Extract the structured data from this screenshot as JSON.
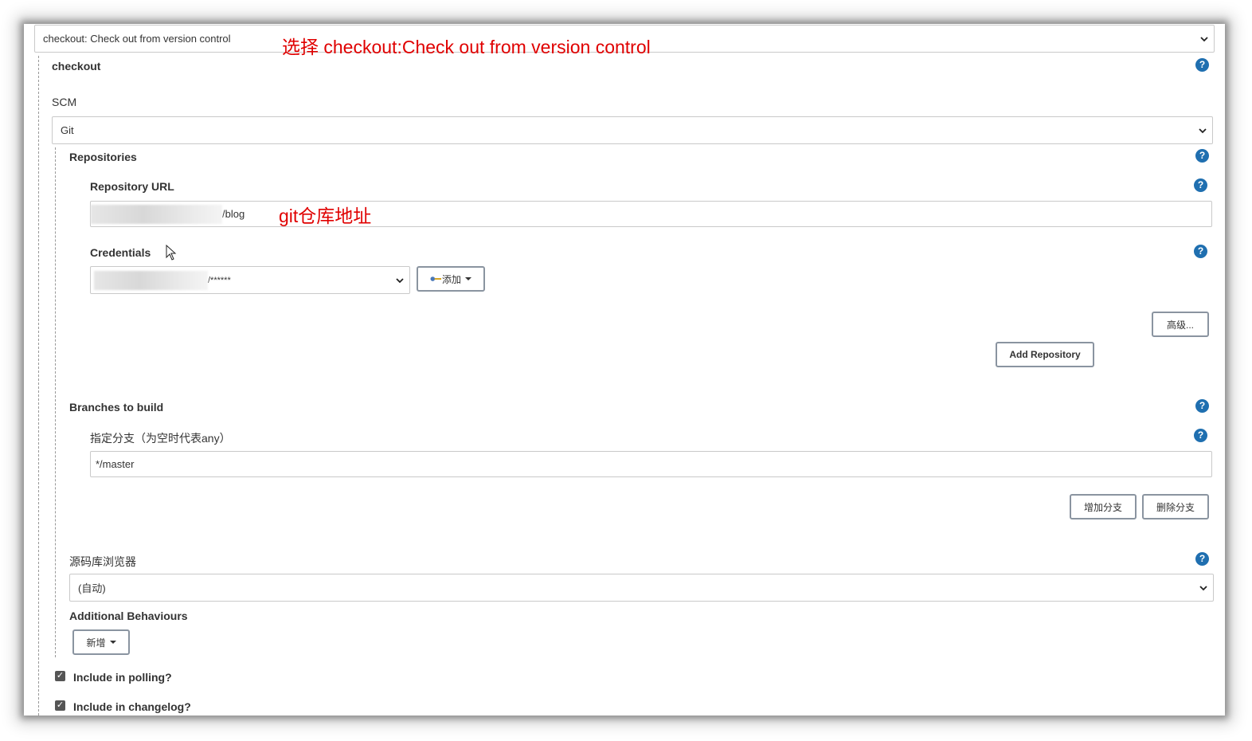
{
  "step_select": {
    "value": "checkout: Check out from version control"
  },
  "annotations": {
    "step_note": "选择 checkout:Check out from version control",
    "repo_url_note": "git仓库地址"
  },
  "step": {
    "title": "checkout",
    "scm_label": "SCM",
    "scm_value": "Git"
  },
  "repositories": {
    "title": "Repositories",
    "url_label": "Repository URL",
    "url_value": "/blog",
    "credentials_label": "Credentials",
    "credentials_value": "/******",
    "add_button": "添加",
    "advanced_button": "高级...",
    "add_repository_button": "Add Repository"
  },
  "branches": {
    "title": "Branches to build",
    "specifier_label": "指定分支（为空时代表any）",
    "specifier_value": "*/master",
    "add_branch_button": "增加分支",
    "delete_branch_button": "删除分支"
  },
  "browser": {
    "label": "源码库浏览器",
    "value": "(自动)"
  },
  "behaviours": {
    "title": "Additional Behaviours",
    "add_button": "新增"
  },
  "options": {
    "polling_label": "Include in polling?",
    "polling_checked": true,
    "changelog_label": "Include in changelog?",
    "changelog_checked": true
  },
  "colors": {
    "help_icon": "#1f6fb0",
    "annotation": "#e00000"
  }
}
